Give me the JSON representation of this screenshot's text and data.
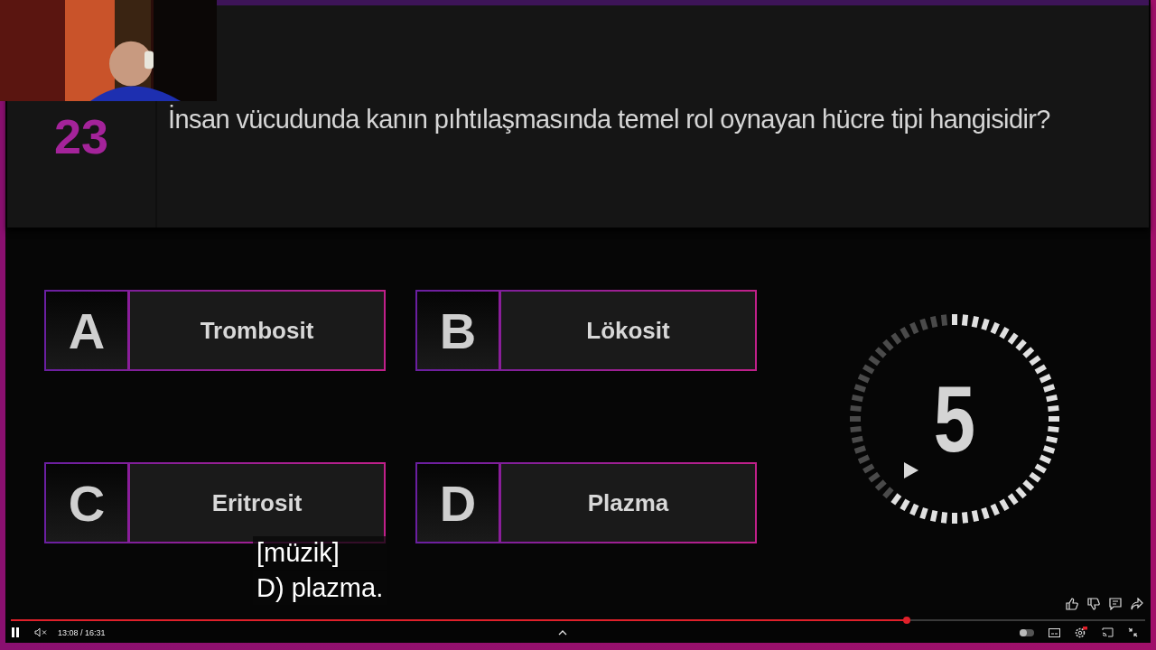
{
  "question": {
    "number": "23",
    "text": "İnsan vücudunda kanın pıhtılaşmasında temel rol oynayan hücre tipi hangisidir?"
  },
  "options": [
    {
      "letter": "A",
      "text": "Trombosit"
    },
    {
      "letter": "B",
      "text": "Lökosit"
    },
    {
      "letter": "C",
      "text": "Eritrosit"
    },
    {
      "letter": "D",
      "text": "Plazma"
    }
  ],
  "timer": {
    "number": "5"
  },
  "subtitles": [
    "[müzik]",
    "D) plazma."
  ],
  "player": {
    "time": "13:08 / 16:31",
    "progress": {
      "level": 0.79
    },
    "playing": true,
    "muted": true,
    "autoplay": false
  }
}
